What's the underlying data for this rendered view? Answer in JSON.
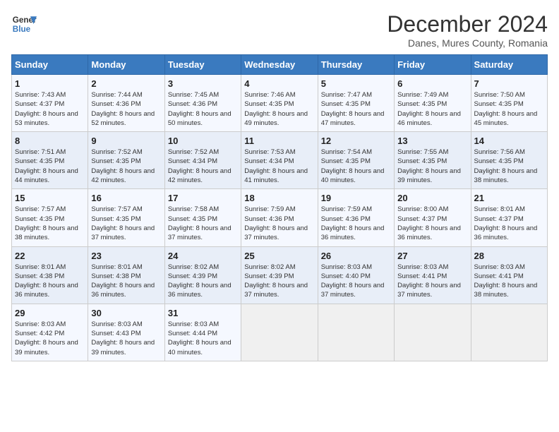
{
  "header": {
    "logo_line1": "General",
    "logo_line2": "Blue",
    "title": "December 2024",
    "subtitle": "Danes, Mures County, Romania"
  },
  "calendar": {
    "days_of_week": [
      "Sunday",
      "Monday",
      "Tuesday",
      "Wednesday",
      "Thursday",
      "Friday",
      "Saturday"
    ],
    "weeks": [
      [
        null,
        null,
        null,
        null,
        null,
        null,
        null
      ]
    ],
    "cells": [
      {
        "day": "",
        "info": ""
      },
      {
        "day": "",
        "info": ""
      },
      {
        "day": "",
        "info": ""
      },
      {
        "day": "",
        "info": ""
      },
      {
        "day": "",
        "info": ""
      },
      {
        "day": "",
        "info": ""
      },
      {
        "day": "",
        "info": ""
      }
    ],
    "rows": [
      [
        {
          "day": "1",
          "sunrise": "Sunrise: 7:43 AM",
          "sunset": "Sunset: 4:37 PM",
          "daylight": "Daylight: 8 hours and 53 minutes."
        },
        {
          "day": "2",
          "sunrise": "Sunrise: 7:44 AM",
          "sunset": "Sunset: 4:36 PM",
          "daylight": "Daylight: 8 hours and 52 minutes."
        },
        {
          "day": "3",
          "sunrise": "Sunrise: 7:45 AM",
          "sunset": "Sunset: 4:36 PM",
          "daylight": "Daylight: 8 hours and 50 minutes."
        },
        {
          "day": "4",
          "sunrise": "Sunrise: 7:46 AM",
          "sunset": "Sunset: 4:35 PM",
          "daylight": "Daylight: 8 hours and 49 minutes."
        },
        {
          "day": "5",
          "sunrise": "Sunrise: 7:47 AM",
          "sunset": "Sunset: 4:35 PM",
          "daylight": "Daylight: 8 hours and 47 minutes."
        },
        {
          "day": "6",
          "sunrise": "Sunrise: 7:49 AM",
          "sunset": "Sunset: 4:35 PM",
          "daylight": "Daylight: 8 hours and 46 minutes."
        },
        {
          "day": "7",
          "sunrise": "Sunrise: 7:50 AM",
          "sunset": "Sunset: 4:35 PM",
          "daylight": "Daylight: 8 hours and 45 minutes."
        }
      ],
      [
        {
          "day": "8",
          "sunrise": "Sunrise: 7:51 AM",
          "sunset": "Sunset: 4:35 PM",
          "daylight": "Daylight: 8 hours and 44 minutes."
        },
        {
          "day": "9",
          "sunrise": "Sunrise: 7:52 AM",
          "sunset": "Sunset: 4:35 PM",
          "daylight": "Daylight: 8 hours and 42 minutes."
        },
        {
          "day": "10",
          "sunrise": "Sunrise: 7:52 AM",
          "sunset": "Sunset: 4:34 PM",
          "daylight": "Daylight: 8 hours and 42 minutes."
        },
        {
          "day": "11",
          "sunrise": "Sunrise: 7:53 AM",
          "sunset": "Sunset: 4:34 PM",
          "daylight": "Daylight: 8 hours and 41 minutes."
        },
        {
          "day": "12",
          "sunrise": "Sunrise: 7:54 AM",
          "sunset": "Sunset: 4:35 PM",
          "daylight": "Daylight: 8 hours and 40 minutes."
        },
        {
          "day": "13",
          "sunrise": "Sunrise: 7:55 AM",
          "sunset": "Sunset: 4:35 PM",
          "daylight": "Daylight: 8 hours and 39 minutes."
        },
        {
          "day": "14",
          "sunrise": "Sunrise: 7:56 AM",
          "sunset": "Sunset: 4:35 PM",
          "daylight": "Daylight: 8 hours and 38 minutes."
        }
      ],
      [
        {
          "day": "15",
          "sunrise": "Sunrise: 7:57 AM",
          "sunset": "Sunset: 4:35 PM",
          "daylight": "Daylight: 8 hours and 38 minutes."
        },
        {
          "day": "16",
          "sunrise": "Sunrise: 7:57 AM",
          "sunset": "Sunset: 4:35 PM",
          "daylight": "Daylight: 8 hours and 37 minutes."
        },
        {
          "day": "17",
          "sunrise": "Sunrise: 7:58 AM",
          "sunset": "Sunset: 4:35 PM",
          "daylight": "Daylight: 8 hours and 37 minutes."
        },
        {
          "day": "18",
          "sunrise": "Sunrise: 7:59 AM",
          "sunset": "Sunset: 4:36 PM",
          "daylight": "Daylight: 8 hours and 37 minutes."
        },
        {
          "day": "19",
          "sunrise": "Sunrise: 7:59 AM",
          "sunset": "Sunset: 4:36 PM",
          "daylight": "Daylight: 8 hours and 36 minutes."
        },
        {
          "day": "20",
          "sunrise": "Sunrise: 8:00 AM",
          "sunset": "Sunset: 4:37 PM",
          "daylight": "Daylight: 8 hours and 36 minutes."
        },
        {
          "day": "21",
          "sunrise": "Sunrise: 8:01 AM",
          "sunset": "Sunset: 4:37 PM",
          "daylight": "Daylight: 8 hours and 36 minutes."
        }
      ],
      [
        {
          "day": "22",
          "sunrise": "Sunrise: 8:01 AM",
          "sunset": "Sunset: 4:38 PM",
          "daylight": "Daylight: 8 hours and 36 minutes."
        },
        {
          "day": "23",
          "sunrise": "Sunrise: 8:01 AM",
          "sunset": "Sunset: 4:38 PM",
          "daylight": "Daylight: 8 hours and 36 minutes."
        },
        {
          "day": "24",
          "sunrise": "Sunrise: 8:02 AM",
          "sunset": "Sunset: 4:39 PM",
          "daylight": "Daylight: 8 hours and 36 minutes."
        },
        {
          "day": "25",
          "sunrise": "Sunrise: 8:02 AM",
          "sunset": "Sunset: 4:39 PM",
          "daylight": "Daylight: 8 hours and 37 minutes."
        },
        {
          "day": "26",
          "sunrise": "Sunrise: 8:03 AM",
          "sunset": "Sunset: 4:40 PM",
          "daylight": "Daylight: 8 hours and 37 minutes."
        },
        {
          "day": "27",
          "sunrise": "Sunrise: 8:03 AM",
          "sunset": "Sunset: 4:41 PM",
          "daylight": "Daylight: 8 hours and 37 minutes."
        },
        {
          "day": "28",
          "sunrise": "Sunrise: 8:03 AM",
          "sunset": "Sunset: 4:41 PM",
          "daylight": "Daylight: 8 hours and 38 minutes."
        }
      ],
      [
        {
          "day": "29",
          "sunrise": "Sunrise: 8:03 AM",
          "sunset": "Sunset: 4:42 PM",
          "daylight": "Daylight: 8 hours and 39 minutes."
        },
        {
          "day": "30",
          "sunrise": "Sunrise: 8:03 AM",
          "sunset": "Sunset: 4:43 PM",
          "daylight": "Daylight: 8 hours and 39 minutes."
        },
        {
          "day": "31",
          "sunrise": "Sunrise: 8:03 AM",
          "sunset": "Sunset: 4:44 PM",
          "daylight": "Daylight: 8 hours and 40 minutes."
        },
        null,
        null,
        null,
        null
      ]
    ]
  }
}
